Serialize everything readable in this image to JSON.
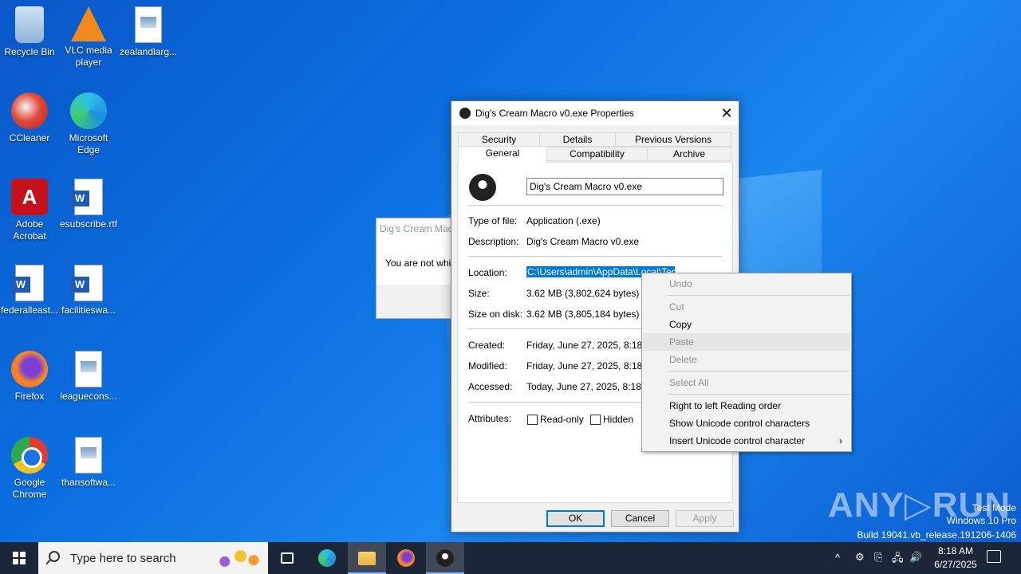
{
  "desktop": {
    "icons": [
      {
        "label": "Recycle Bin",
        "icon": "recycle-bin-icon"
      },
      {
        "label": "VLC media player",
        "icon": "vlc-icon"
      },
      {
        "label": "zealandlarg...",
        "icon": "image-file-icon"
      },
      {
        "label": "CCleaner",
        "icon": "ccleaner-icon"
      },
      {
        "label": "Microsoft Edge",
        "icon": "edge-icon"
      },
      {
        "label": "Adobe Acrobat",
        "icon": "acrobat-icon"
      },
      {
        "label": "esubscribe.rtf",
        "icon": "word-doc-icon"
      },
      {
        "label": "federalleast...",
        "icon": "word-doc-icon"
      },
      {
        "label": "facilitieswa...",
        "icon": "word-doc-icon"
      },
      {
        "label": "Firefox",
        "icon": "firefox-icon"
      },
      {
        "label": "leaguecons...",
        "icon": "image-file-icon"
      },
      {
        "label": "Google Chrome",
        "icon": "chrome-icon"
      },
      {
        "label": "thansoftwa...",
        "icon": "image-file-icon"
      }
    ]
  },
  "background_dialog": {
    "title": "Dig's Cream Mac",
    "message": "You are not whit"
  },
  "properties_window": {
    "title": "Dig's Cream Macro v0.exe Properties",
    "close_glyph": "✕",
    "tabs_row1": [
      "Security",
      "Details",
      "Previous Versions"
    ],
    "tabs_row2": [
      "General",
      "Compatibility",
      "Archive"
    ],
    "active_tab": "General",
    "file_name": "Dig's Cream Macro v0.exe",
    "type_label": "Type of file:",
    "type_value": "Application (.exe)",
    "desc_label": "Description:",
    "desc_value": "Dig's Cream Macro v0.exe",
    "location_label": "Location:",
    "location_value": "C:\\Users\\admin\\AppData\\Local\\Temp",
    "size_label": "Size:",
    "size_value": "3.62 MB (3,802,624 bytes)",
    "size_disk_label": "Size on disk:",
    "size_disk_value": "3.62 MB (3,805,184 bytes)",
    "created_label": "Created:",
    "created_value": "Friday, June 27, 2025, 8:18:17",
    "modified_label": "Modified:",
    "modified_value": "Friday, June 27, 2025, 8:18:17",
    "accessed_label": "Accessed:",
    "accessed_value": "Today, June 27, 2025, 8:18:17",
    "attributes_label": "Attributes:",
    "readonly_label": "Read-only",
    "hidden_label": "Hidden",
    "ok_label": "OK",
    "cancel_label": "Cancel",
    "apply_label": "Apply"
  },
  "context_menu": {
    "items": [
      {
        "label": "Undo",
        "enabled": false
      },
      {
        "label": "Cut",
        "enabled": false
      },
      {
        "label": "Copy",
        "enabled": true
      },
      {
        "label": "Paste",
        "enabled": false
      },
      {
        "label": "Delete",
        "enabled": false
      },
      {
        "label": "Select All",
        "enabled": false
      },
      {
        "label": "Right to left Reading order",
        "enabled": true
      },
      {
        "label": "Show Unicode control characters",
        "enabled": true
      },
      {
        "label": "Insert Unicode control character",
        "enabled": true
      }
    ],
    "submenu_arrow": "›"
  },
  "watermark": {
    "brand": "ANY▷RUN",
    "mode": "Test Mode",
    "edition": "Windows 10 Pro",
    "build": "Build 19041.vb_release.191206-1406"
  },
  "taskbar": {
    "search_placeholder": "Type here to search",
    "time": "8:18 AM",
    "date": "6/27/2025",
    "tray_glyphs": [
      "^",
      "⚙",
      "⎘",
      "🖧",
      "🔊"
    ]
  },
  "colors": {
    "accent": "#0078d7",
    "taskbar": "#1b2738",
    "desktop": "#0b6fe0"
  }
}
